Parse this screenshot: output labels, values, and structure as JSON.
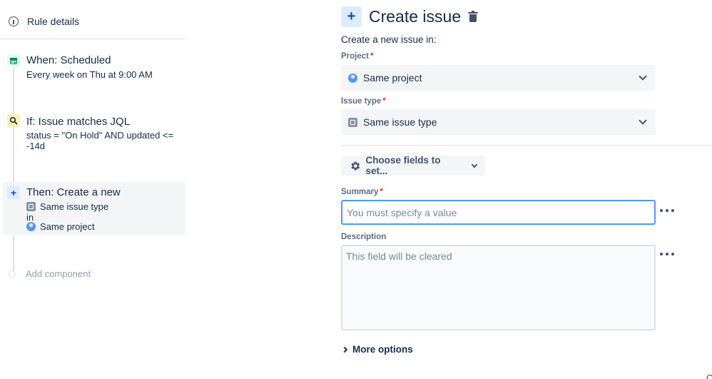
{
  "sidebar": {
    "rule_details": "Rule details",
    "steps": {
      "when": {
        "title": "When: Scheduled",
        "desc": "Every week on Thu at 9:00 AM"
      },
      "if": {
        "title": "If: Issue matches JQL",
        "desc": "status = \"On Hold\" AND updated <= -14d"
      },
      "then": {
        "title": "Then: Create a new",
        "issue_type": "Same issue type",
        "in": "in",
        "project": "Same project"
      }
    },
    "add_component": "Add component"
  },
  "panel": {
    "title": "Create issue",
    "subtitle": "Create a new issue in:",
    "project": {
      "label": "Project",
      "value": "Same project"
    },
    "issue_type": {
      "label": "Issue type",
      "value": "Same issue type"
    },
    "choose_fields": "Choose fields to set...",
    "summary": {
      "label": "Summary",
      "placeholder": "You must specify a value"
    },
    "description": {
      "label": "Description",
      "placeholder": "This field will be cleared"
    },
    "more_options": "More options",
    "required_mark": "*",
    "edge_link": "C"
  },
  "icons": {
    "rule_details": "info-icon",
    "when": "calendar-icon",
    "if": "search-icon",
    "then": "plus-icon",
    "delete": "trash-icon",
    "choose_fields": "gear-icon"
  },
  "colors": {
    "accent": "#0052cc",
    "focus_border": "#4c9aff",
    "required": "#de350b",
    "when_badge": "#e3fcef",
    "if_badge": "#fff0b3",
    "then_badge": "#deebff"
  }
}
